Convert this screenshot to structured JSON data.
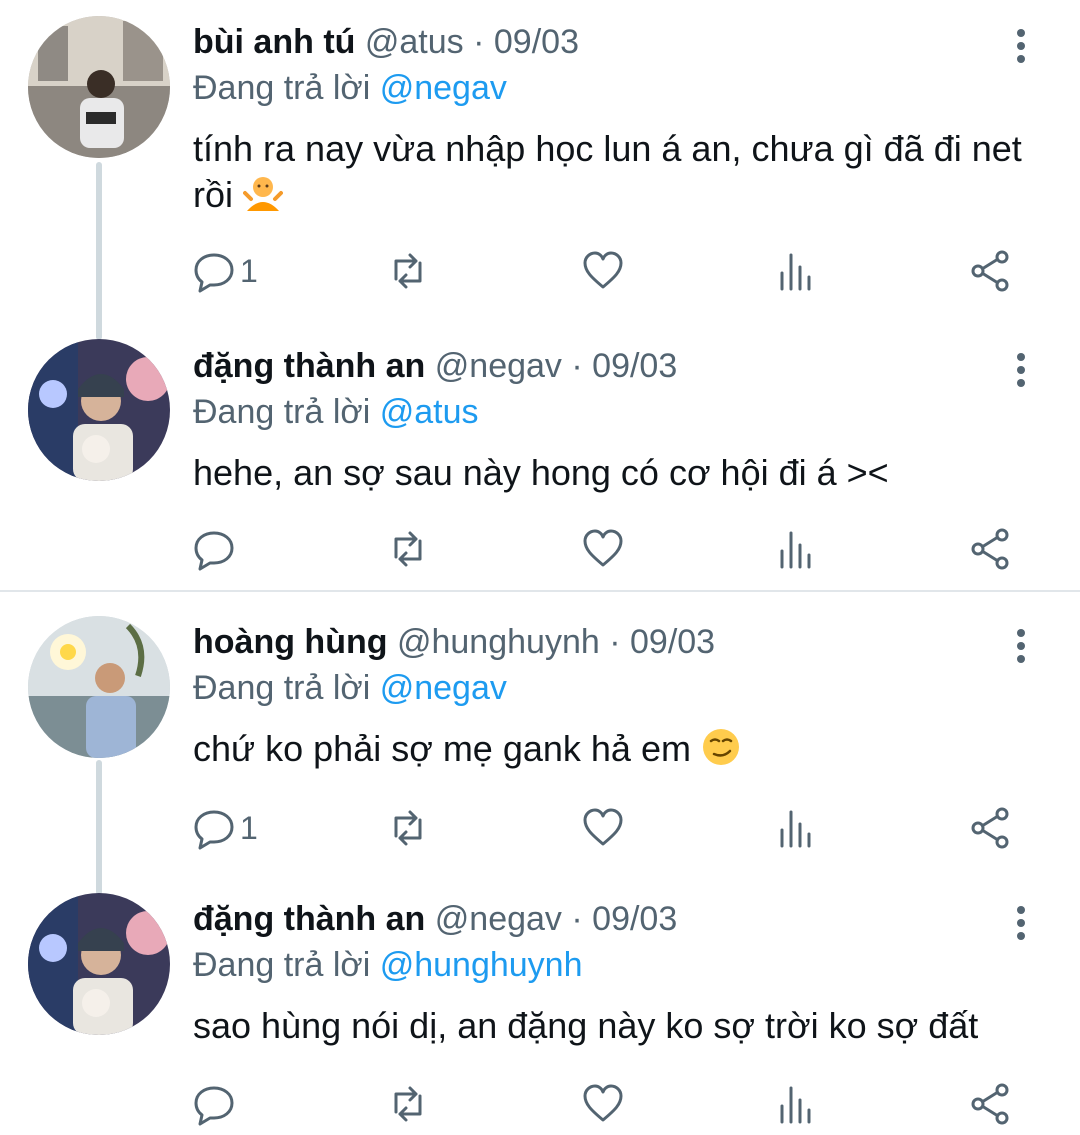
{
  "tweets": [
    {
      "name": "bùi anh tú",
      "handle": "@atus",
      "dot": "·",
      "date": "09/03",
      "replying_label": "Đang trả lời ",
      "replying_to": "@negav",
      "text": "tính ra nay vừa nhập học lun á an, chưa gì đã đi net rồi",
      "emoji": "shrug-emoji",
      "reply_count": "1"
    },
    {
      "name": "đặng thành an",
      "handle": "@negav",
      "dot": "·",
      "date": "09/03",
      "replying_label": "Đang trả lời ",
      "replying_to": "@atus",
      "text": "hehe, an sợ sau này hong có cơ hội đi á ><",
      "reply_count": ""
    },
    {
      "name": "hoàng hùng",
      "handle": "@hunghuynh",
      "dot": "·",
      "date": "09/03",
      "replying_label": "Đang trả lời ",
      "replying_to": "@negav",
      "text": "chứ ko phải sợ mẹ gank hả em",
      "emoji": "smirk-emoji",
      "reply_count": "1"
    },
    {
      "name": "đặng thành an",
      "handle": "@negav",
      "dot": "·",
      "date": "09/03",
      "replying_label": "Đang trả lời ",
      "replying_to": "@hunghuynh",
      "text": "sao hùng nói dị, an đặng này ko sợ trời ko sợ đất",
      "reply_count": ""
    }
  ],
  "colors": {
    "text": "#0f1419",
    "secondary": "#536471",
    "link": "#1d9bf0",
    "thread_line": "#cfd9de"
  }
}
